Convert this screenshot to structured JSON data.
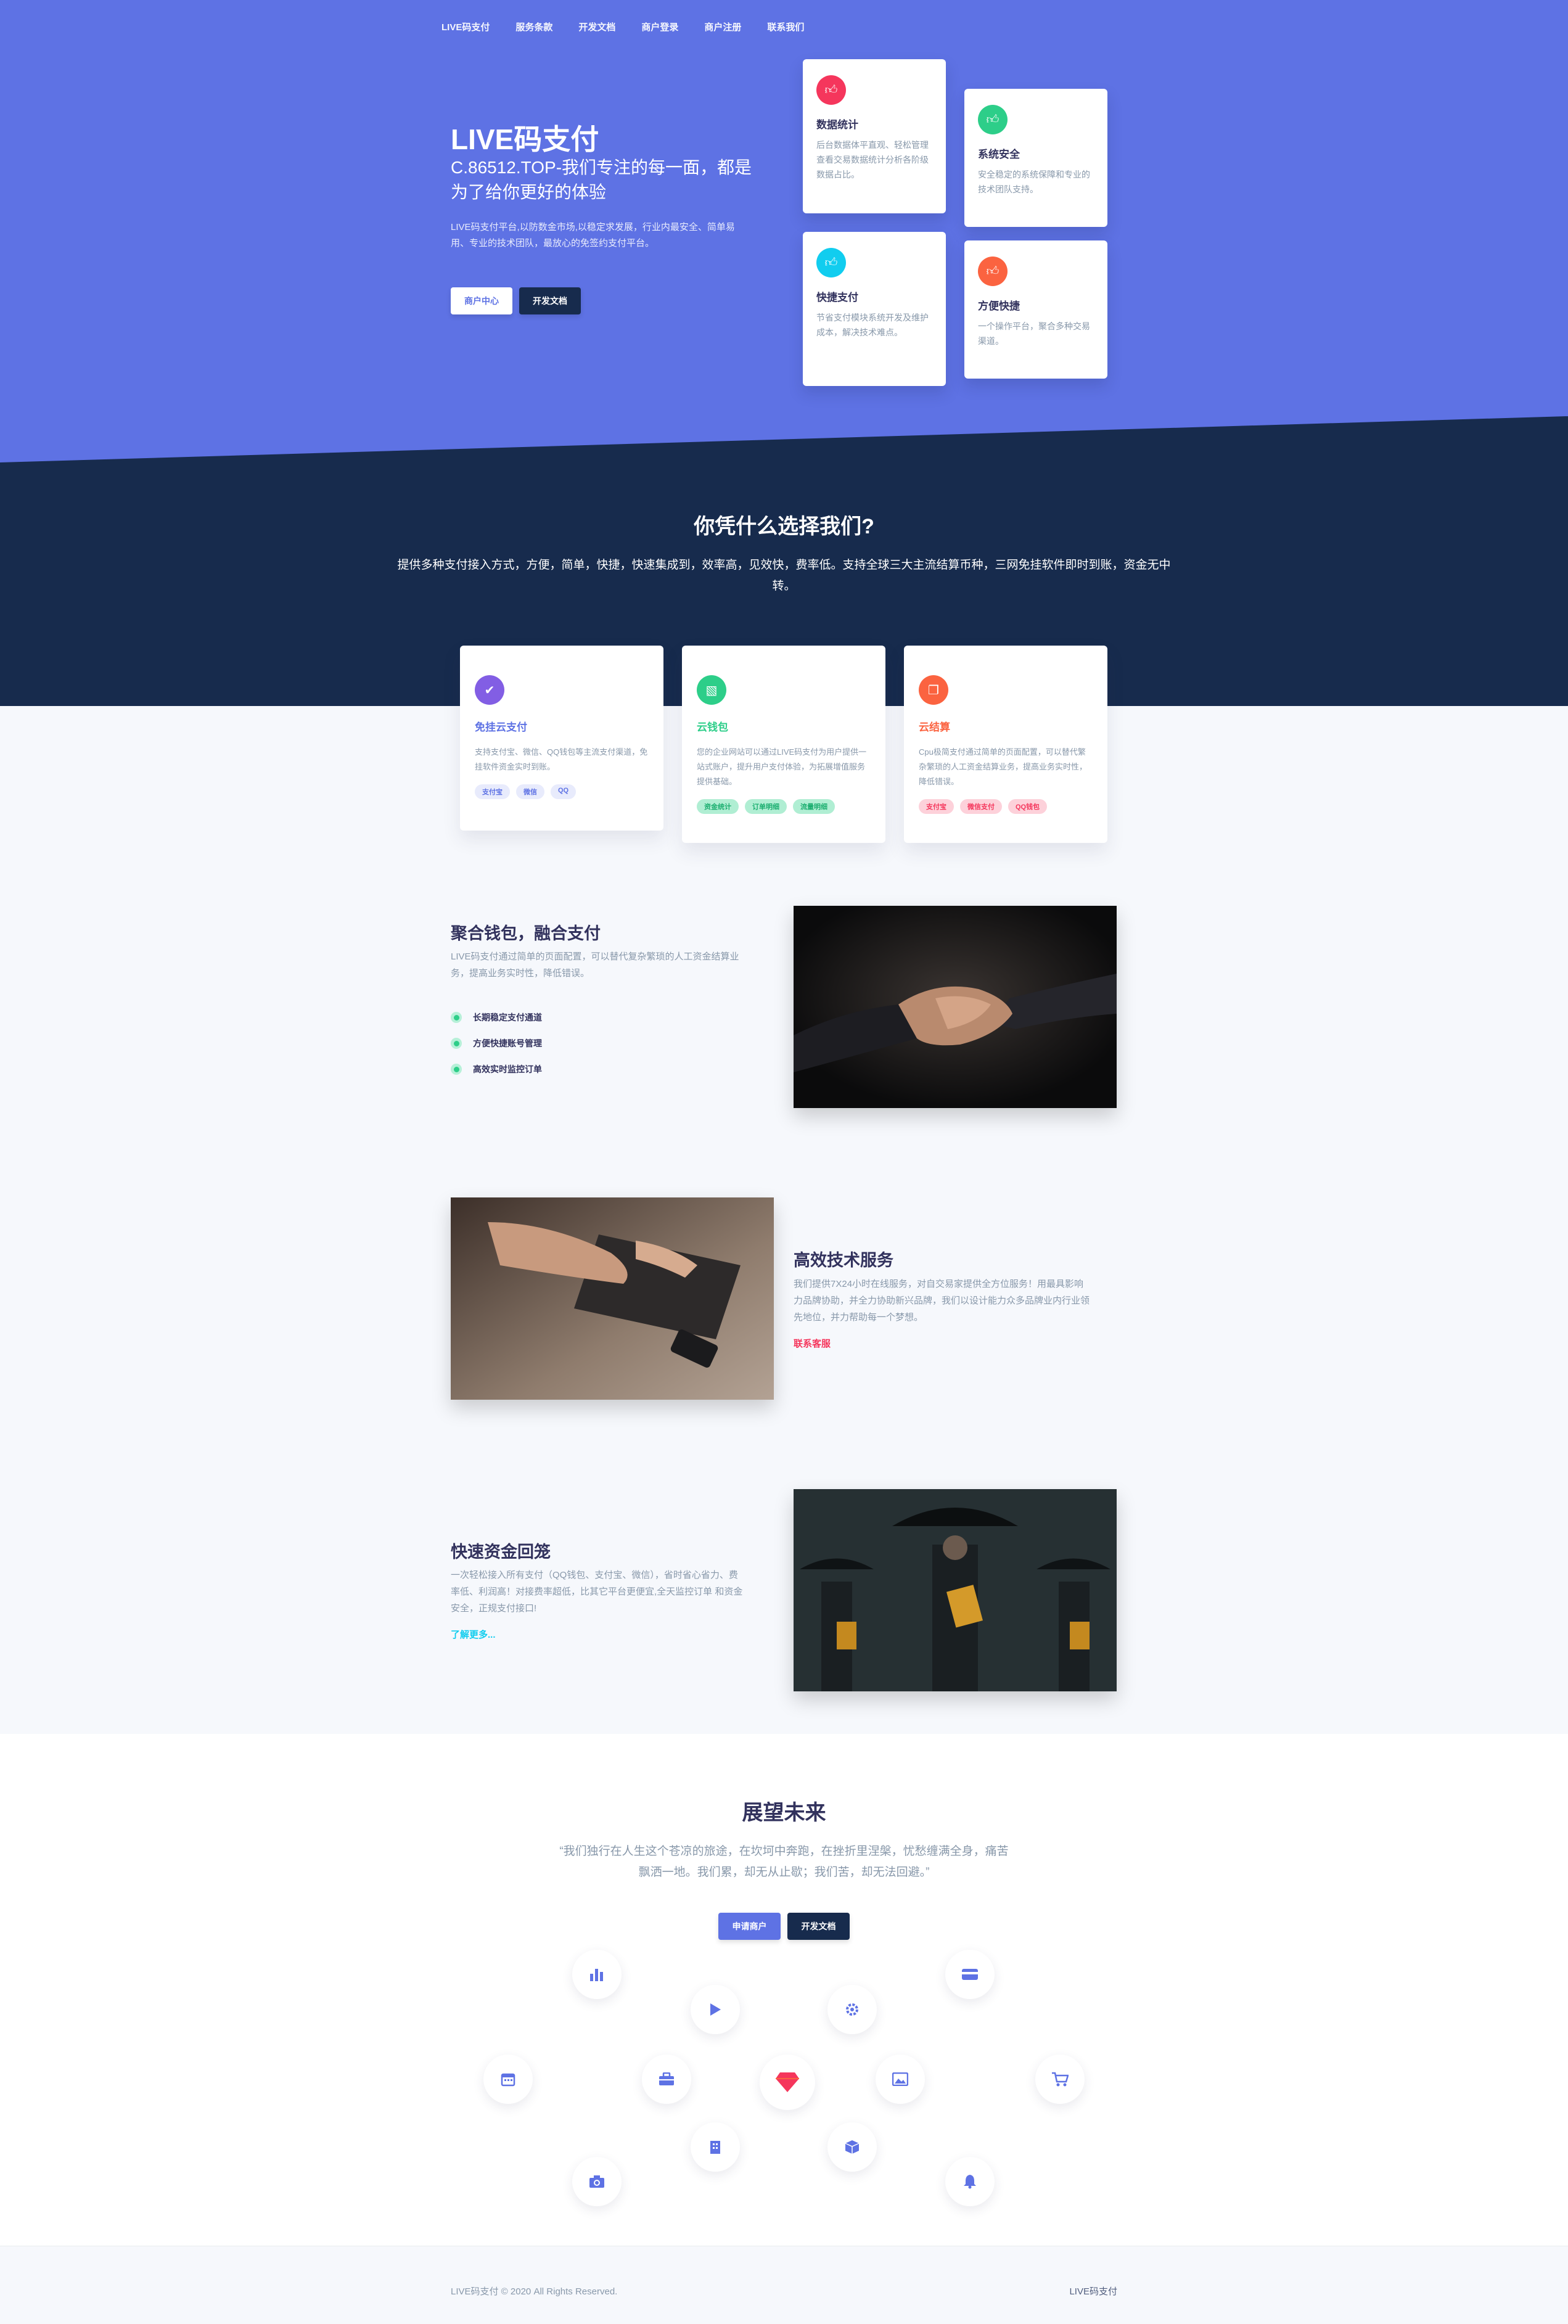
{
  "colors": {
    "primary": "#5e72e4",
    "dark": "#172b4d",
    "red": "#f5365c",
    "teal": "#2dce89",
    "cyan": "#11cdef",
    "orange": "#fb6340",
    "indigo": "#825ee4"
  },
  "nav": [
    "LIVE码支付",
    "服务条款",
    "开发文档",
    "商户登录",
    "商户注册",
    "联系我们"
  ],
  "hero": {
    "title": "LIVE码支付",
    "subtitle": "C.86512.TOP-我们专注的每一面，都是为了给你更好的体验",
    "desc": "LIVE码支付平台,以防数金市场,以稳定求发展，行业内最安全、简单易用、专业的技术团队，最放心的免签约支付平台。",
    "btn_merchant": "商户中心",
    "btn_docs": "开发文档"
  },
  "features": [
    {
      "icon": "thumb-icon",
      "title": "数据统计",
      "desc": "后台数据体平直观、轻松管理查看交易数据统计分析各阶级数据占比。"
    },
    {
      "icon": "thumb-icon",
      "title": "系统安全",
      "desc": "安全稳定的系统保障和专业的技术团队支持。"
    },
    {
      "icon": "thumb-icon",
      "title": "快捷支付",
      "desc": "节省支付模块系统开发及维护成本，解决技术难点。"
    },
    {
      "icon": "thumb-icon",
      "title": "方便快捷",
      "desc": "一个操作平台，聚合多种交易渠道。"
    }
  ],
  "why": {
    "title": "你凭什么选择我们?",
    "desc": "提供多种支付接入方式，方便，简单，快捷，快速集成到，效率高，见效快，费率低。支持全球三大主流结算币种，三网免挂软件即时到账，资金无中转。"
  },
  "services": [
    {
      "title": "免挂云支付",
      "desc": "支持支付宝、微信、QQ钱包等主流支付渠道，免挂软件资金实时到账。",
      "tags": [
        "支付宝",
        "微信",
        "QQ"
      ]
    },
    {
      "title": "云钱包",
      "desc": "您的企业网站可以通过LIVE码支付为用户提供一站式账户，提升用户支付体验，为拓展增值服务提供基础。",
      "tags": [
        "资金统计",
        "订单明细",
        "流量明细"
      ]
    },
    {
      "title": "云结算",
      "desc": "Cpu极简支付通过简单的页面配置，可以替代繁杂繁琐的人工资金结算业务，提高业务实时性，降低错误。",
      "tags": [
        "支付宝",
        "微信支付",
        "QQ钱包"
      ]
    }
  ],
  "sec1": {
    "title": "聚合钱包，融合支付",
    "desc": "LIVE码支付通过简单的页面配置，可以替代复杂繁琐的人工资金结算业务，提高业务实时性，降低错误。",
    "items": [
      "长期稳定支付通道",
      "方便快捷账号管理",
      "高效实时监控订单"
    ]
  },
  "sec2": {
    "title": "高效技术服务",
    "desc": "我们提供7X24小时在线服务，对自交易家提供全方位服务！用最具影响力品牌协助，并全力协助新兴品牌，我们以设计能力众多品牌业内行业领先地位，并力帮助每一个梦想。",
    "link": "联系客服"
  },
  "sec3": {
    "title": "快速资金回笼",
    "desc": "一次轻松接入所有支付（QQ钱包、支付宝、微信），省时省心省力、费率低、利润高！对接费率超低，比其它平台更便宜,全天监控订单 和资金安全，正规支付接口!",
    "link": "了解更多..."
  },
  "future": {
    "title": "展望未来",
    "desc": "“我们独行在人生这个苍凉的旅途，在坎坷中奔跑，在挫折里涅槃，忧愁缠满全身，痛苦飘洒一地。我们累，却无从止歇；我们苦，却无法回避。”",
    "btn_apply": "申请商户",
    "btn_docs": "开发文档",
    "icons": [
      "bar-chart-icon",
      "credit-card-icon",
      "play-icon",
      "gear-icon",
      "calendar-icon",
      "briefcase-icon",
      "diamond-icon",
      "image-icon",
      "cart-icon",
      "building-icon",
      "box-icon",
      "camera-icon",
      "bell-icon"
    ]
  },
  "footer": {
    "copyright": "LIVE码支付 © 2020 All Rights Reserved.",
    "brand": "LIVE码支付"
  }
}
